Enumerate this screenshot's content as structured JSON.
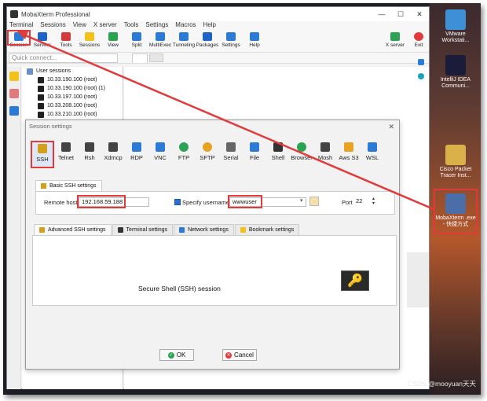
{
  "app": {
    "title": "MobaXterm Professional",
    "window_controls": [
      "—",
      "☐",
      "✕"
    ]
  },
  "menu": [
    "Terminal",
    "Sessions",
    "View",
    "X server",
    "Tools",
    "Settings",
    "Macros",
    "Help"
  ],
  "toolbar": {
    "items": [
      {
        "label": "Session",
        "icon": "session-icon",
        "color": "#2b7bd6"
      },
      {
        "label": "Servers",
        "icon": "servers-icon",
        "color": "#1e63c6"
      },
      {
        "label": "Tools",
        "icon": "tools-icon",
        "color": "#d43a3a"
      },
      {
        "label": "Sessions",
        "icon": "star-icon",
        "color": "#f2c21b"
      },
      {
        "label": "View",
        "icon": "view-icon",
        "color": "#2aa352"
      },
      {
        "label": "Split",
        "icon": "split-icon",
        "color": "#2b7bd6"
      },
      {
        "label": "MultiExec",
        "icon": "multiexec-icon",
        "color": "#2b7bd6"
      },
      {
        "label": "Tunneling",
        "icon": "tunneling-icon",
        "color": "#2b7bd6"
      },
      {
        "label": "Packages",
        "icon": "packages-icon",
        "color": "#1e63c6"
      },
      {
        "label": "Settings",
        "icon": "settings-icon",
        "color": "#2b7bd6"
      },
      {
        "label": "Help",
        "icon": "help-icon",
        "color": "#2b7bd6"
      }
    ],
    "right_items": [
      {
        "label": "X server",
        "icon": "xserver-icon",
        "color": "#2aa352"
      },
      {
        "label": "Exit",
        "icon": "exit-icon",
        "color": "#e23a3a"
      }
    ]
  },
  "quick_connect": {
    "placeholder": "Quick connect..."
  },
  "tree": {
    "root": "User sessions",
    "items": [
      "10.33.190.100 (root)",
      "10.33.190.100 (root) (1)",
      "10.33.197.100 (root)",
      "10.33.208.100 (root)",
      "10.33.210.100 (root)"
    ]
  },
  "dialog": {
    "title": "Session settings",
    "session_types": [
      {
        "label": "SSH",
        "icon": "ssh-icon",
        "color": "#d4a01b",
        "selected": true
      },
      {
        "label": "Telnet",
        "icon": "telnet-icon",
        "color": "#444"
      },
      {
        "label": "Rsh",
        "icon": "rsh-icon",
        "color": "#444"
      },
      {
        "label": "Xdmcp",
        "icon": "xdmcp-icon",
        "color": "#444"
      },
      {
        "label": "RDP",
        "icon": "rdp-icon",
        "color": "#2b7bd6"
      },
      {
        "label": "VNC",
        "icon": "vnc-icon",
        "color": "#2b7bd6"
      },
      {
        "label": "FTP",
        "icon": "ftp-icon",
        "color": "#2aa352"
      },
      {
        "label": "SFTP",
        "icon": "sftp-icon",
        "color": "#e8a320"
      },
      {
        "label": "Serial",
        "icon": "serial-icon",
        "color": "#666"
      },
      {
        "label": "File",
        "icon": "file-icon",
        "color": "#2b7bd6"
      },
      {
        "label": "Shell",
        "icon": "shell-icon",
        "color": "#333"
      },
      {
        "label": "Browser",
        "icon": "browser-icon",
        "color": "#2aa352"
      },
      {
        "label": "Mosh",
        "icon": "mosh-icon",
        "color": "#444"
      },
      {
        "label": "Aws S3",
        "icon": "aws-icon",
        "color": "#e8a320"
      },
      {
        "label": "WSL",
        "icon": "wsl-icon",
        "color": "#2b7bd6"
      }
    ],
    "basic_tab": "Basic SSH settings",
    "remote_host_label": "Remote host",
    "remote_host_value": "192.168.59.188",
    "specify_username_label": "Specify username",
    "username_value": "wwwuser",
    "port_label": "Port",
    "port_value": "22",
    "adv_tabs": [
      {
        "label": "Advanced SSH settings",
        "icon": "advanced-icon",
        "color": "#d4a01b"
      },
      {
        "label": "Terminal settings",
        "icon": "terminal-icon",
        "color": "#333"
      },
      {
        "label": "Network settings",
        "icon": "network-icon",
        "color": "#2b7bd6"
      },
      {
        "label": "Bookmark settings",
        "icon": "bookmark-icon",
        "color": "#f2c21b"
      }
    ],
    "description": "Secure Shell (SSH) session",
    "ok_label": "OK",
    "cancel_label": "Cancel"
  },
  "desktop_icons": [
    {
      "label": "VMware Workstati...",
      "icon": "vmware-icon",
      "color": "#3d8fd6"
    },
    {
      "label": "IntelliJ IDEA Communi...",
      "icon": "intellij-icon",
      "color": "#1b1b3a"
    },
    {
      "label": "Cisco Packet Tracer Inst...",
      "icon": "cisco-icon",
      "color": "#d9b04a"
    },
    {
      "label": "MobaXterm .exe - 快捷方式",
      "icon": "mobaxterm-icon",
      "color": "#4a6ea8"
    }
  ],
  "watermark": "CSDN @mooyuan天天"
}
